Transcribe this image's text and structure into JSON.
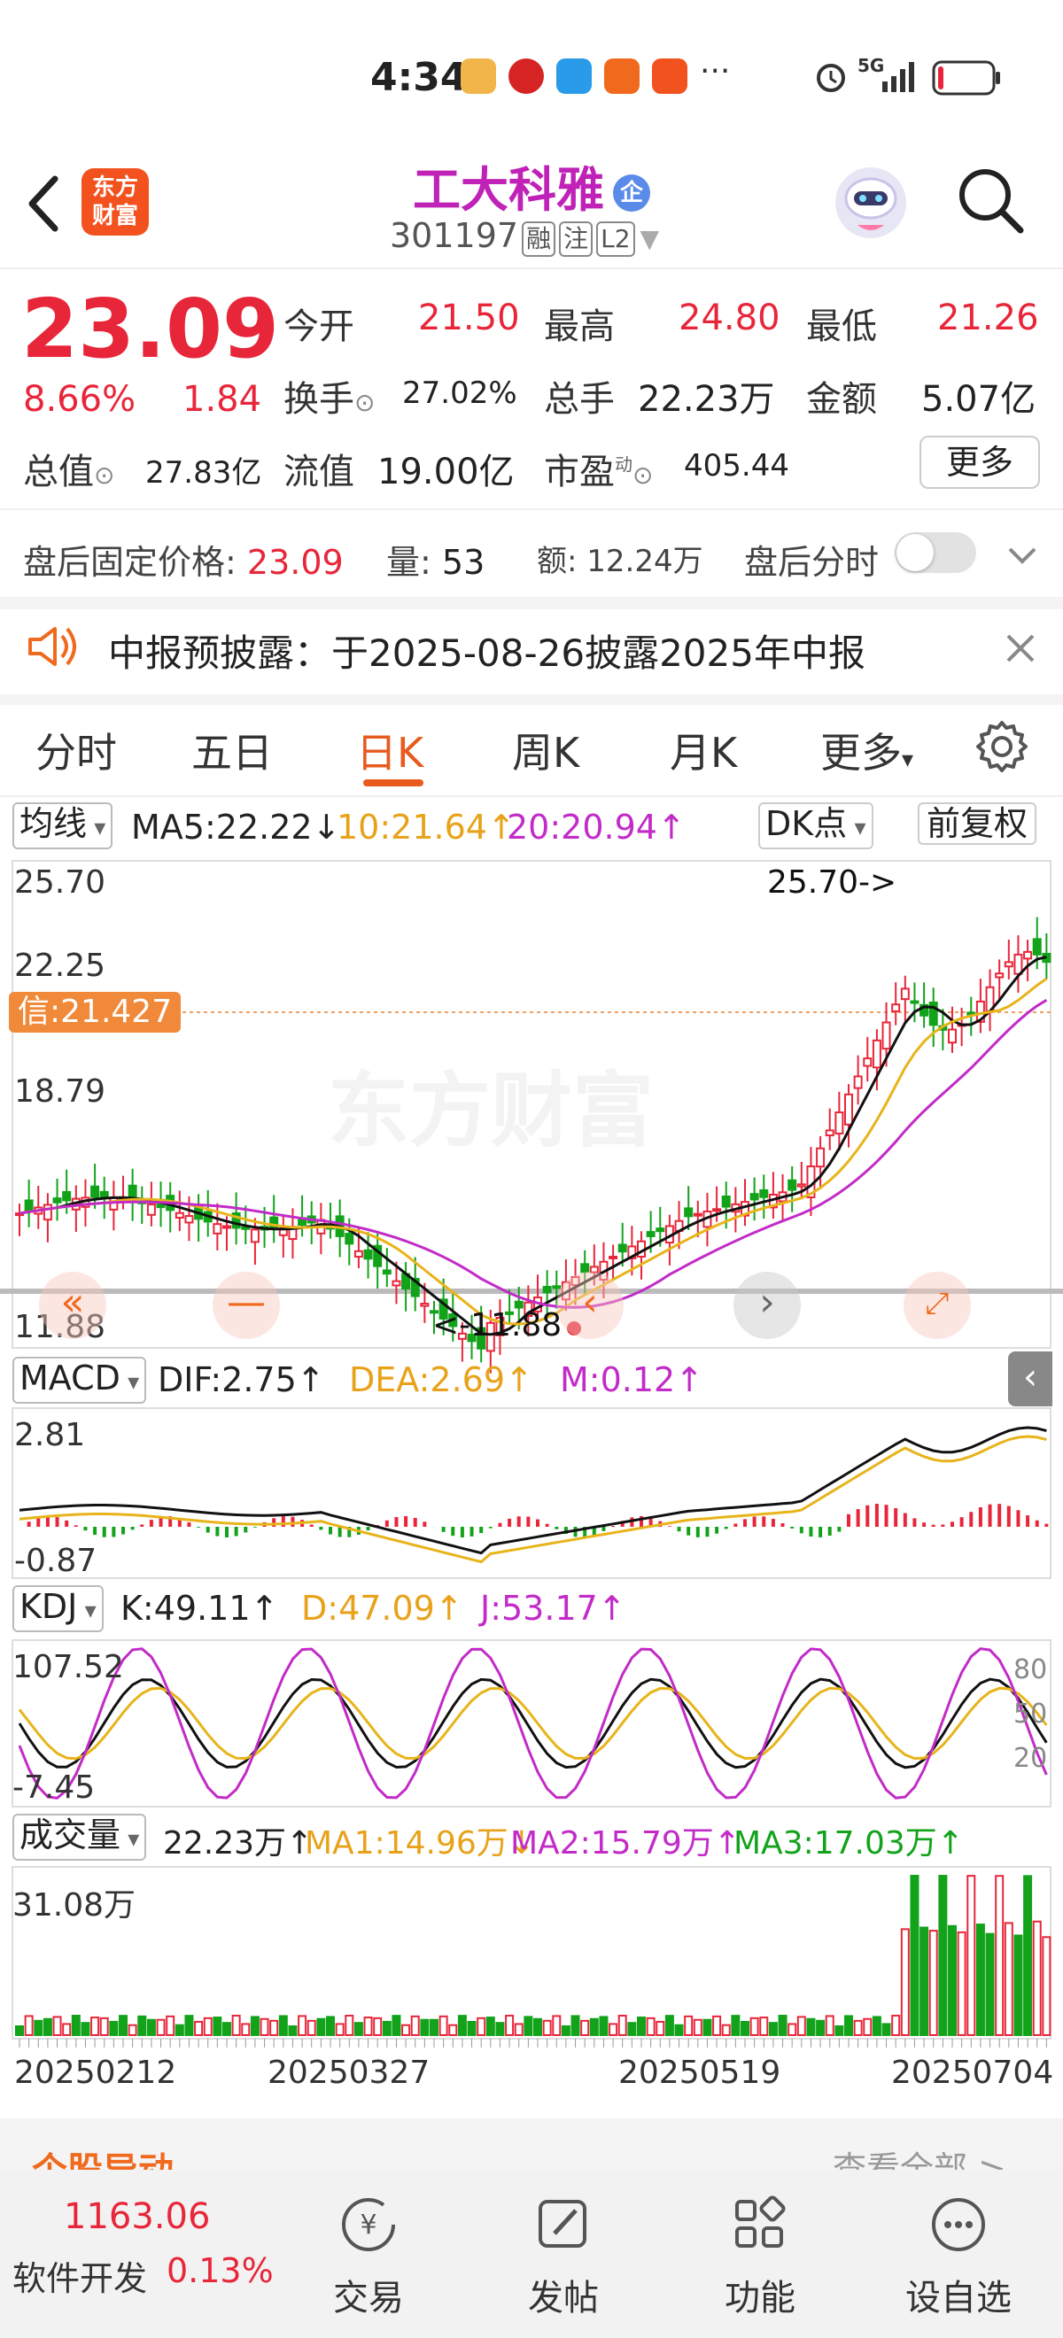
{
  "status_bar": {
    "time": "4:34",
    "network": "5G",
    "battery_icon": "battery-low-icon"
  },
  "header": {
    "back_icon": "chevron-left-icon",
    "app_logo_text": "东方\n财富",
    "stock_name": "工大科雅",
    "enterprise_badge": "企",
    "stock_code": "301197",
    "tags": [
      "融",
      "注",
      "L2"
    ],
    "search_icon": "search-icon"
  },
  "quote": {
    "price": "23.09",
    "change_pct": "8.66%",
    "change_amt": "1.84",
    "open_label": "今开",
    "open": "21.50",
    "high_label": "最高",
    "high": "24.80",
    "low_label": "最低",
    "low": "21.26",
    "turnover_label": "换手",
    "turnover": "27.02%",
    "volume_label": "总手",
    "volume": "22.23万",
    "amount_label": "金额",
    "amount": "5.07亿",
    "mktcap_label": "总值",
    "mktcap": "27.83亿",
    "float_label": "流值",
    "float_cap": "19.00亿",
    "pe_label": "市盈",
    "pe_super": "动",
    "pe": "405.44",
    "more_label": "更多"
  },
  "after_hours": {
    "price_label": "盘后固定价格:",
    "price": "23.09",
    "vol_label": "量:",
    "vol": "53",
    "amt_label": "额:",
    "amt": "12.24万",
    "timeshare_label": "盘后分时"
  },
  "notice": {
    "text": "中报预披露：于2025-08-26披露2025年中报"
  },
  "tabs": [
    "分时",
    "五日",
    "日K",
    "周K",
    "月K",
    "更多"
  ],
  "active_tab": "日K",
  "kline": {
    "ma_label": "均线",
    "ma5": "MA5:22.22↓",
    "ma10": "10:21.64↑",
    "ma20": "20:20.94↑",
    "dk_label": "DK点",
    "adjust_label": "前复权",
    "y_labels": [
      "25.70",
      "22.25",
      "18.79",
      "11.88"
    ],
    "ref_label": "信:21.427",
    "high_marker": "25.70->",
    "low_marker": "<-11.88",
    "watermark": "东方财富"
  },
  "macd": {
    "label": "MACD",
    "dif": "DIF:2.75↑",
    "dea": "DEA:2.69↑",
    "m": "M:0.12↑",
    "y_top": "2.81",
    "y_bottom": "-0.87"
  },
  "kdj": {
    "label": "KDJ",
    "k": "K:49.11↑",
    "d": "D:47.09↑",
    "j": "J:53.17↑",
    "y_top": "107.52",
    "y_bottom": "-7.45",
    "right_ticks": [
      "80",
      "50",
      "20"
    ]
  },
  "volume": {
    "label": "成交量",
    "value": "22.23万↑",
    "ma1": "MA1:14.96万↓",
    "ma2": "MA2:15.79万↑",
    "ma3": "MA3:17.03万↑",
    "y_top": "31.08万"
  },
  "x_dates": [
    "20250212",
    "20250327",
    "20250519",
    "20250704"
  ],
  "section_peek": {
    "title": "个股异动",
    "more": "查看全部 >"
  },
  "bottom_nav": {
    "index_value": "1163.06",
    "index_name": "软件开发",
    "index_change": "0.13%",
    "items": [
      "交易",
      "发帖",
      "功能",
      "设自选"
    ]
  },
  "colors": {
    "up": "#e8263a",
    "down": "#12a31a",
    "ma5": "#111111",
    "ma10": "#e8b41a",
    "ma20": "#c22bc8",
    "accent": "#e85a1e"
  }
}
